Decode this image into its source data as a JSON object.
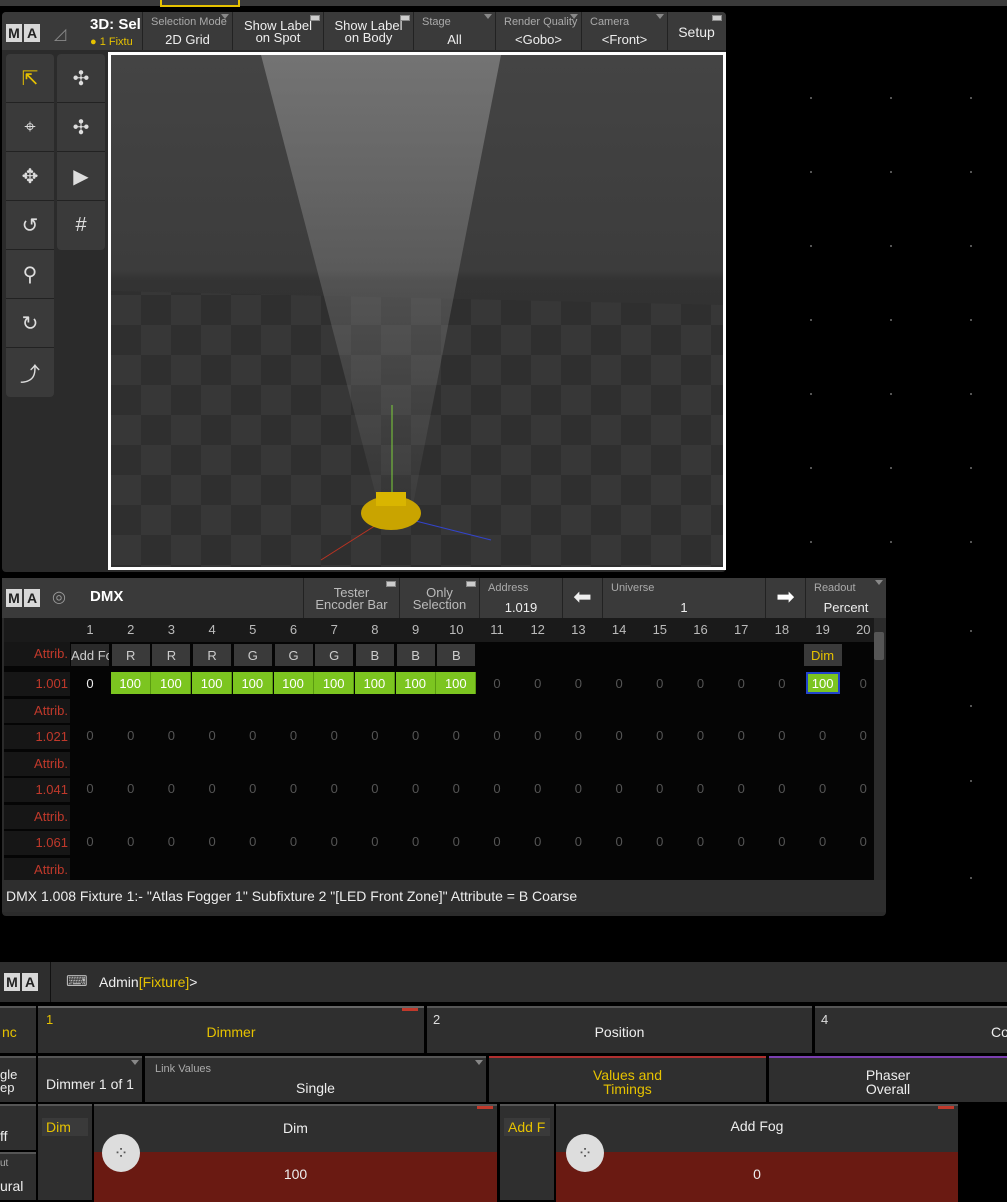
{
  "topbar": {},
  "ma": {
    "m": "M",
    "a": "A"
  },
  "win3d": {
    "title": "3D: Sel",
    "subtitle": "1 Fixtu",
    "selection_mode": {
      "label": "Selection Mode",
      "value": "2D Grid"
    },
    "show_label_spot": {
      "line1": "Show Label",
      "line2": "on Spot"
    },
    "show_label_body": {
      "line1": "Show Label",
      "line2": "on Body"
    },
    "stage": {
      "label": "Stage",
      "value": "All"
    },
    "render_quality": {
      "label": "Render Quality",
      "value": "<Gobo>"
    },
    "camera": {
      "label": "Camera",
      "value": "<Front>"
    },
    "setup": "Setup"
  },
  "dmx": {
    "title": "DMX",
    "tester": {
      "line1": "Tester",
      "line2": "Encoder Bar"
    },
    "only": {
      "line1": "Only",
      "line2": "Selection"
    },
    "address": {
      "label": "Address",
      "value": "1.019"
    },
    "universe": {
      "label": "Universe",
      "value": "1"
    },
    "readout": {
      "label": "Readout",
      "value": "Percent"
    },
    "columns": [
      "1",
      "2",
      "3",
      "4",
      "5",
      "6",
      "7",
      "8",
      "9",
      "10",
      "11",
      "12",
      "13",
      "14",
      "15",
      "16",
      "17",
      "18",
      "19",
      "20"
    ],
    "attrib_label": "Attrib.",
    "row1_attribs": [
      "Add Fo",
      "R",
      "R",
      "R",
      "G",
      "G",
      "G",
      "B",
      "B",
      "B",
      "",
      "",
      "",
      "",
      "",
      "",
      "",
      "",
      "Dim",
      ""
    ],
    "row1_label": "1.001",
    "row1_values": [
      "0",
      "100",
      "100",
      "100",
      "100",
      "100",
      "100",
      "100",
      "100",
      "100",
      "0",
      "0",
      "0",
      "0",
      "0",
      "0",
      "0",
      "0",
      "100",
      "0"
    ],
    "rows": [
      {
        "label": "1.021",
        "values": [
          "0",
          "0",
          "0",
          "0",
          "0",
          "0",
          "0",
          "0",
          "0",
          "0",
          "0",
          "0",
          "0",
          "0",
          "0",
          "0",
          "0",
          "0",
          "0",
          "0"
        ]
      },
      {
        "label": "1.041",
        "values": [
          "0",
          "0",
          "0",
          "0",
          "0",
          "0",
          "0",
          "0",
          "0",
          "0",
          "0",
          "0",
          "0",
          "0",
          "0",
          "0",
          "0",
          "0",
          "0",
          "0"
        ]
      },
      {
        "label": "1.061",
        "values": [
          "0",
          "0",
          "0",
          "0",
          "0",
          "0",
          "0",
          "0",
          "0",
          "0",
          "0",
          "0",
          "0",
          "0",
          "0",
          "0",
          "0",
          "0",
          "0",
          "0"
        ]
      }
    ],
    "status": "DMX 1.008  Fixture 1:-  \"Atlas Fogger 1\" Subfixture 2 \"[LED Front Zone]\" Attribute = B Coarse"
  },
  "cmd": {
    "user": "Admin",
    "mode": "[Fixture]",
    "prompt": ">"
  },
  "features": {
    "left_tab": "nc",
    "items": [
      {
        "num": "1",
        "label": "Dimmer"
      },
      {
        "num": "2",
        "label": "Position"
      },
      {
        "num": "4",
        "label": "Co"
      }
    ]
  },
  "toolbar2": {
    "left_a": "gle",
    "left_b": "ep",
    "dimmer_page": "Dimmer 1 of 1",
    "link_values": {
      "label": "Link Values",
      "value": "Single"
    },
    "values_timings": {
      "line1": "Values and",
      "line2": "Timings"
    },
    "phaser": {
      "line1": "Phaser",
      "line2": "Overall"
    },
    "left_off": "ff",
    "left_out_label": "ut",
    "left_out_value": "ural"
  },
  "encoders": [
    {
      "tag": "Dim",
      "name": "Dim",
      "value": "100"
    },
    {
      "tag": "Add F",
      "name": "Add Fog",
      "value": "0"
    }
  ]
}
